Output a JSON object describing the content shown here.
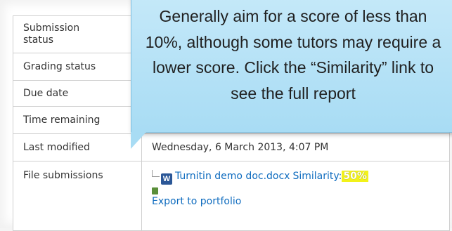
{
  "table": {
    "rows": [
      {
        "label": "Submission\nstatus",
        "value": ""
      },
      {
        "label": "Grading status",
        "value": ""
      },
      {
        "label": "Due date",
        "value": ""
      },
      {
        "label": "Time remaining",
        "value": ""
      },
      {
        "label": "Last modified",
        "value": "Wednesday, 6 March 2013, 4:07 PM"
      },
      {
        "label": "File submissions",
        "value": ""
      }
    ],
    "file": {
      "icon": "word-doc-icon",
      "icon_glyph": "W",
      "name": "Turnitin demo doc.docx",
      "similarity_label": "Similarity:",
      "similarity_value": "50%",
      "export_label": "Export to portfolio"
    }
  },
  "callout": {
    "text": "Generally aim for a score of less than 10%, although some tutors may require a lower score. Click the “Similarity” link to see the full report"
  },
  "colors": {
    "link": "#0f6cbf",
    "similarity_badge": "#f2f21a",
    "callout_bg": "#b8e2f6"
  }
}
